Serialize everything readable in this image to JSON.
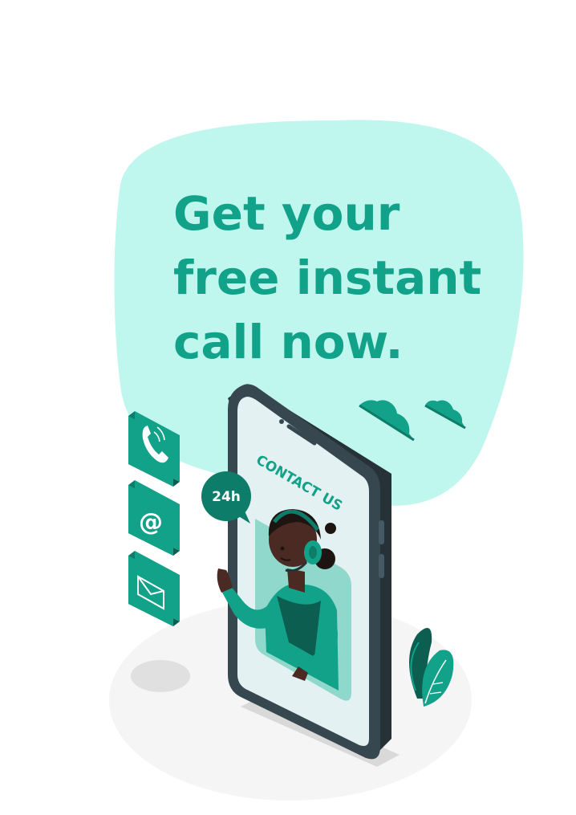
{
  "headline": {
    "line1": "Get your",
    "line2": "free instant",
    "line3": "call now."
  },
  "phone": {
    "screen_heading": "CONTACT US"
  },
  "badge": {
    "label": "24h"
  },
  "contact_icons": [
    "phone-icon",
    "at-sign-icon",
    "envelope-icon"
  ],
  "colors": {
    "accent": "#12a28a",
    "accent_dark": "#0d7d69",
    "blob": "#bff7ee",
    "phone_body": "#37474f",
    "screen": "#e3f1f2",
    "ground": "#f5f5f5",
    "skin": "#4a2a22"
  }
}
